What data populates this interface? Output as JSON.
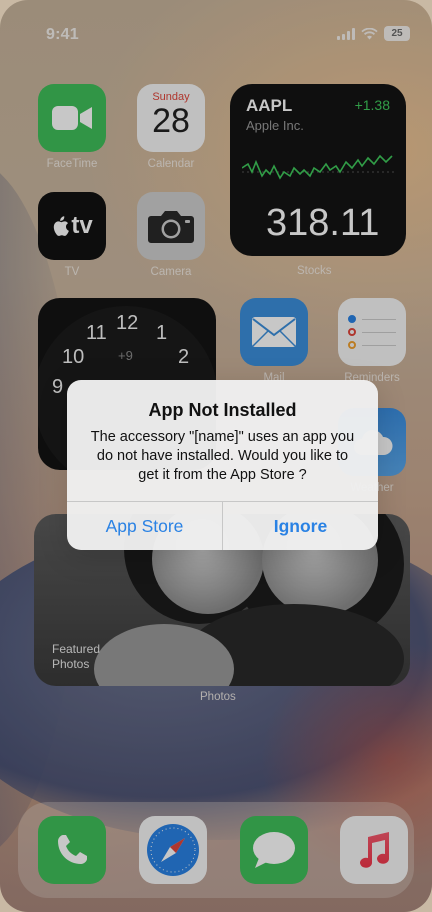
{
  "status": {
    "time": "9:41",
    "battery": "25"
  },
  "apps": {
    "facetime": "FaceTime",
    "calendar": "Calendar",
    "tv": "TV",
    "camera": "Camera",
    "mail": "Mail",
    "reminders": "Reminders",
    "weather": "Weather"
  },
  "calendar": {
    "weekday": "Sunday",
    "date": "28"
  },
  "tv_icon_text": "tv",
  "stocks": {
    "symbol": "AAPL",
    "name": "Apple Inc.",
    "change": "+1.38",
    "price": "318.11",
    "label": "Stocks"
  },
  "clock": {
    "numbers": [
      "11",
      "12",
      "1",
      "10",
      "2",
      "9"
    ],
    "offset": "+9"
  },
  "photos": {
    "caption_line1": "Featured",
    "caption_line2": "Photos",
    "label": "Photos"
  },
  "alert": {
    "title": "App Not Installed",
    "message": "The accessory \"[name]\" uses an app you do not have installed. Would you like to get it from the App Store ?",
    "btn_app_store": "App Store",
    "btn_ignore": "Ignore"
  },
  "dock": [
    "phone-icon",
    "safari-icon",
    "messages-icon",
    "music-icon"
  ],
  "colors": {
    "accent": "#2a82e4",
    "stocks_up": "#3fc95c",
    "green": "#3fbf5a"
  }
}
